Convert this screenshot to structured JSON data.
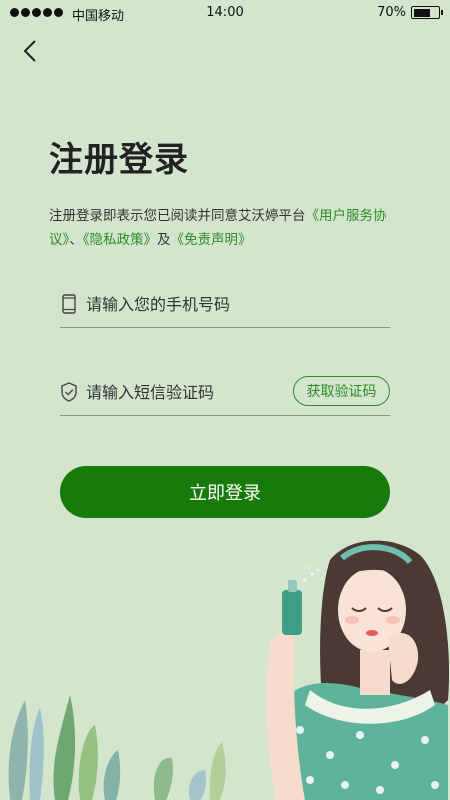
{
  "status_bar": {
    "carrier": "中国移动",
    "time": "14:00",
    "battery_text": "70%",
    "battery_level": 0.7
  },
  "nav": {
    "back_icon": "chevron-left-icon"
  },
  "page": {
    "title": "注册登录"
  },
  "agreement": {
    "prefix": "注册登录即表示您已阅读并同意艾沃婷平台",
    "user_agreement": "《用户服务协议》",
    "sep": "、",
    "privacy_policy": "《隐私政策》",
    "and": "及",
    "disclaimer": "《免责声明》"
  },
  "form": {
    "phone": {
      "placeholder": "请输入您的手机号码",
      "value": "",
      "icon": "phone-icon"
    },
    "code": {
      "placeholder": "请输入短信验证码",
      "value": "",
      "icon": "shield-check-icon"
    },
    "get_code_label": "获取验证码",
    "login_label": "立即登录"
  },
  "colors": {
    "background": "#d3e6cd",
    "primary": "#197a0c",
    "link": "#2f8a2a"
  }
}
